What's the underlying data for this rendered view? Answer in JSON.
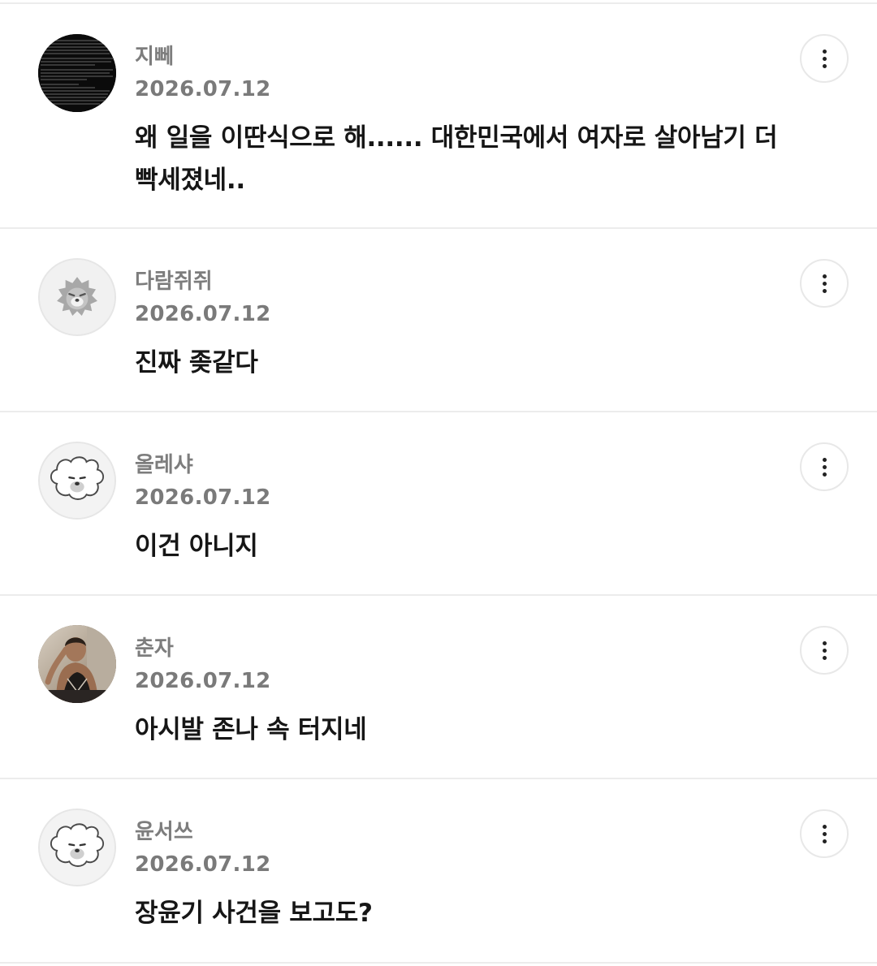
{
  "comments": [
    {
      "author": "지뻬",
      "date": "2026.07.12",
      "text": "왜 일을 이딴식으로 해...... 대한민국에서 여자로 살아남기 더 빡세졌네..",
      "avatar": "dark-text-screenshot-photo"
    },
    {
      "author": "다람쥐쥐",
      "date": "2026.07.12",
      "text": "진짜 좆같다",
      "avatar": "default-lion-character-icon"
    },
    {
      "author": "올레샤",
      "date": "2026.07.12",
      "text": "이건 아니지",
      "avatar": "default-poodle-character-icon"
    },
    {
      "author": "춘자",
      "date": "2026.07.12",
      "text": "아시발 존나 속 터지네",
      "avatar": "user-photo"
    },
    {
      "author": "윤서쓰",
      "date": "2026.07.12",
      "text": "장윤기 사건을 보고도?",
      "avatar": "default-poodle-character-icon"
    }
  ],
  "more_button_icon": "vertical-ellipsis-icon",
  "colors": {
    "author": "#7d7d7d",
    "date": "#7a7a7a",
    "body": "#161616",
    "divider": "#ececec"
  }
}
